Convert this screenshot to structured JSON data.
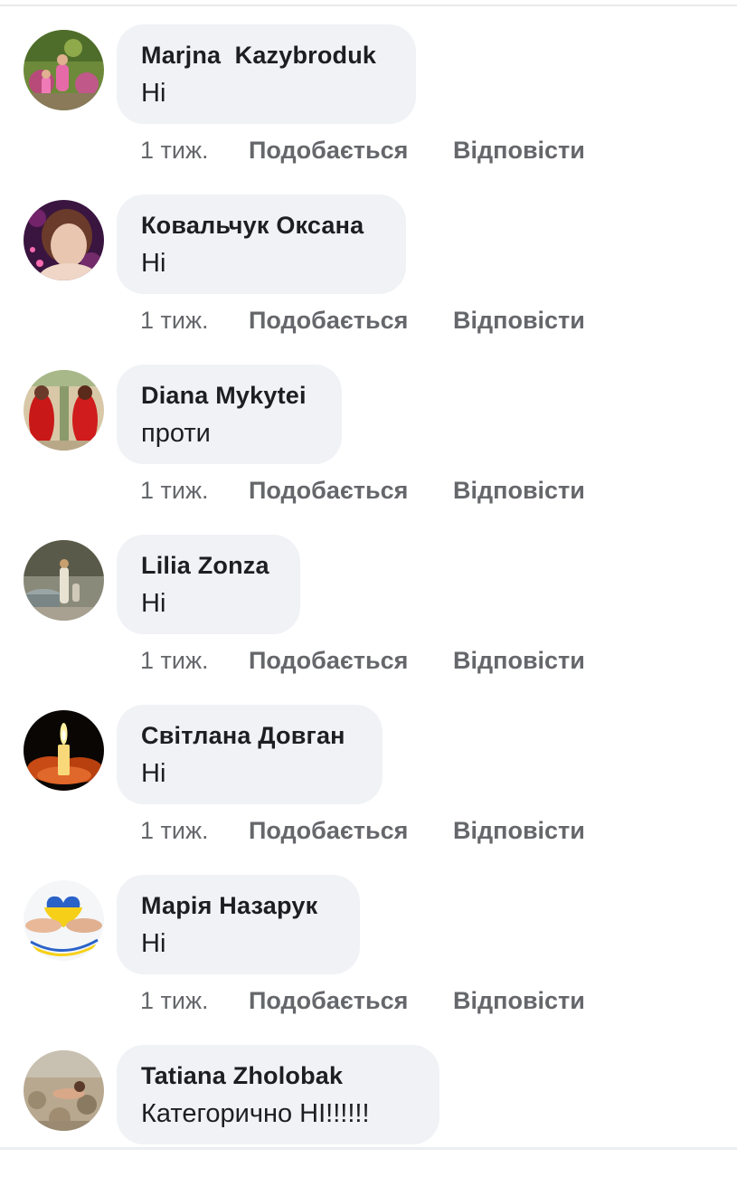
{
  "comments": [
    {
      "author": "Marjna  Kazybroduk",
      "text": "Ні",
      "time": "1 тиж.",
      "like_label": "Подобається",
      "reply_label": "Відповісти",
      "avatar_icon": "profile-photo-icon"
    },
    {
      "author": "Ковальчук Оксана",
      "text": "Ні",
      "time": "1 тиж.",
      "like_label": "Подобається",
      "reply_label": "Відповісти",
      "avatar_icon": "profile-photo-icon"
    },
    {
      "author": "Diana Mykytei",
      "text": "проти",
      "time": "1 тиж.",
      "like_label": "Подобається",
      "reply_label": "Відповісти",
      "avatar_icon": "profile-photo-icon"
    },
    {
      "author": "Lilia Zonza",
      "text": "Ні",
      "time": "1 тиж.",
      "like_label": "Подобається",
      "reply_label": "Відповісти",
      "avatar_icon": "profile-photo-icon"
    },
    {
      "author": "Світлана Довган",
      "text": "Ні",
      "time": "1 тиж.",
      "like_label": "Подобається",
      "reply_label": "Відповісти",
      "avatar_icon": "candle-icon"
    },
    {
      "author": "Марія Назарук",
      "text": "Ні",
      "time": "1 тиж.",
      "like_label": "Подобається",
      "reply_label": "Відповісти",
      "avatar_icon": "ukraine-heart-icon"
    },
    {
      "author": "Tatiana Zholobak",
      "text": "Категорично НІ!!!!!!",
      "avatar_icon": "profile-photo-icon"
    }
  ],
  "colors": {
    "bubble_bg": "#f0f2f5",
    "text": "#1c1e21",
    "secondary": "#65676b"
  }
}
